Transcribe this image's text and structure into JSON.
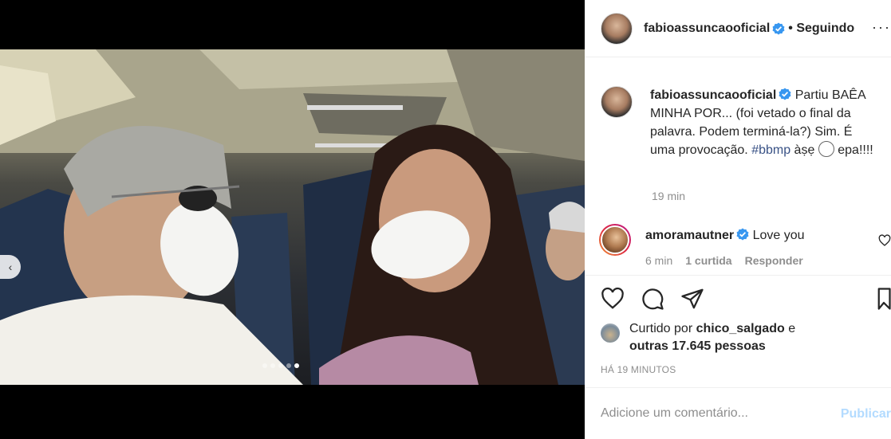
{
  "post": {
    "author": "fabioassuncaooficial",
    "following_label": "• Seguindo",
    "more_label": "···",
    "slide_count": 5,
    "active_slide": 5
  },
  "caption": {
    "username": "fabioassuncaooficial",
    "text_before": " Partiu BAÊA MINHA POR... (foi vetado o final da palavra. Podem terminá-la?) Sim. É uma provocação. ",
    "hashtag": "#bbmp",
    "text_after": " àṣẹ ",
    "text_end": " epa!!!!",
    "time": "19 min"
  },
  "comment": {
    "username": "amoramautner",
    "text": " Love you",
    "time": "6 min",
    "likes": "1 curtida",
    "reply": "Responder"
  },
  "likes": {
    "prefix": "Curtido por ",
    "user": "chico_salgado",
    "middle": " e",
    "others": "outras 17.645 pessoas"
  },
  "timestamp": "HÁ 19 MINUTOS",
  "add_comment": {
    "placeholder": "Adicione um comentário...",
    "publish": "Publicar"
  },
  "icons": [
    "chevron-left-icon",
    "heart-icon",
    "comment-icon",
    "share-icon",
    "bookmark-icon",
    "verified-badge-icon"
  ],
  "colors": {
    "link": "#385185",
    "verified": "#3897f0",
    "publish": "#b3dbff"
  }
}
